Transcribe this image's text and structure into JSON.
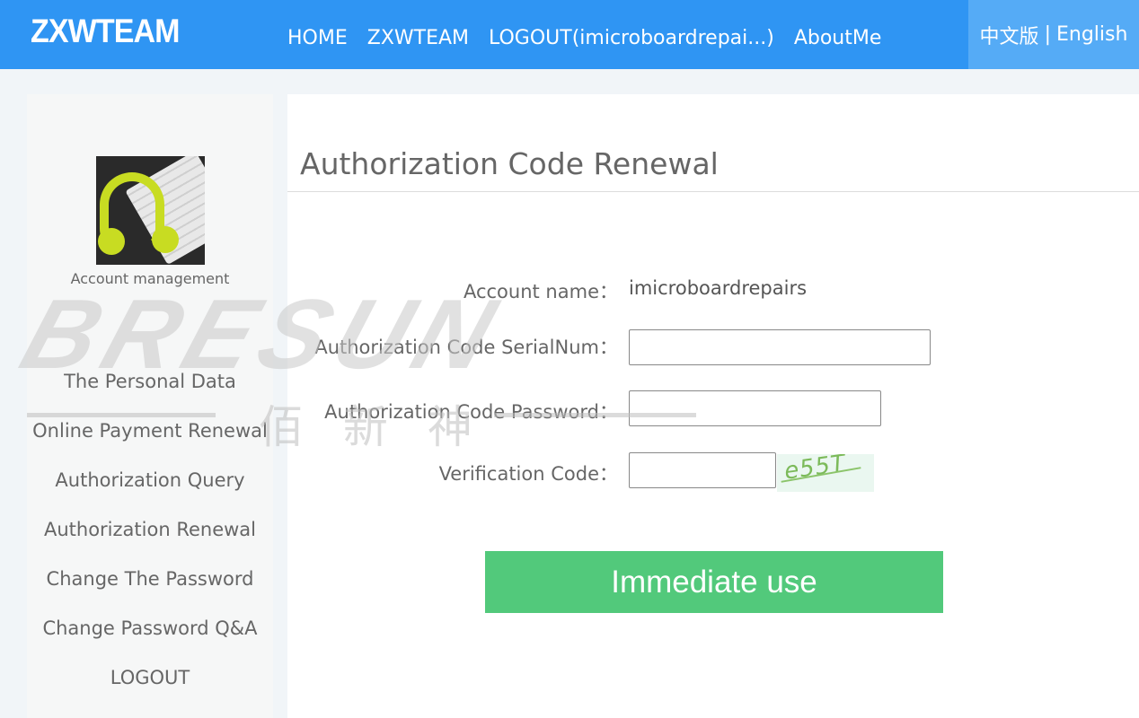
{
  "header": {
    "logo": "ZXWTEAM",
    "nav": [
      "HOME",
      "ZXWTEAM",
      "LOGOUT(imicroboardrepai...)",
      "AboutMe"
    ],
    "lang_cn": "中文版",
    "lang_sep": "|",
    "lang_en": "English"
  },
  "sidebar": {
    "account_label": "Account management",
    "items": [
      "The Personal Data",
      "Online Payment Renewal",
      "Authorization Query",
      "Authorization Renewal",
      "Change The Password",
      "Change Password Q&A",
      "LOGOUT"
    ]
  },
  "main": {
    "title": "Authorization Code Renewal",
    "account_name_label": "Account name：",
    "account_name_value": "imicroboardrepairs",
    "serial_label": "Authorization Code SerialNum：",
    "serial_value": "",
    "password_label": "Authorization Code Password：",
    "password_value": "",
    "verify_label": "Verification Code：",
    "verify_value": "",
    "captcha_text": "e55T",
    "submit_label": "Immediate use"
  },
  "watermark": {
    "text": "BRESUN",
    "cn_text": "佰 新 神"
  },
  "colors": {
    "topbar": "#2f95f3",
    "lang_box": "#55abf6",
    "button": "#52c97b"
  }
}
